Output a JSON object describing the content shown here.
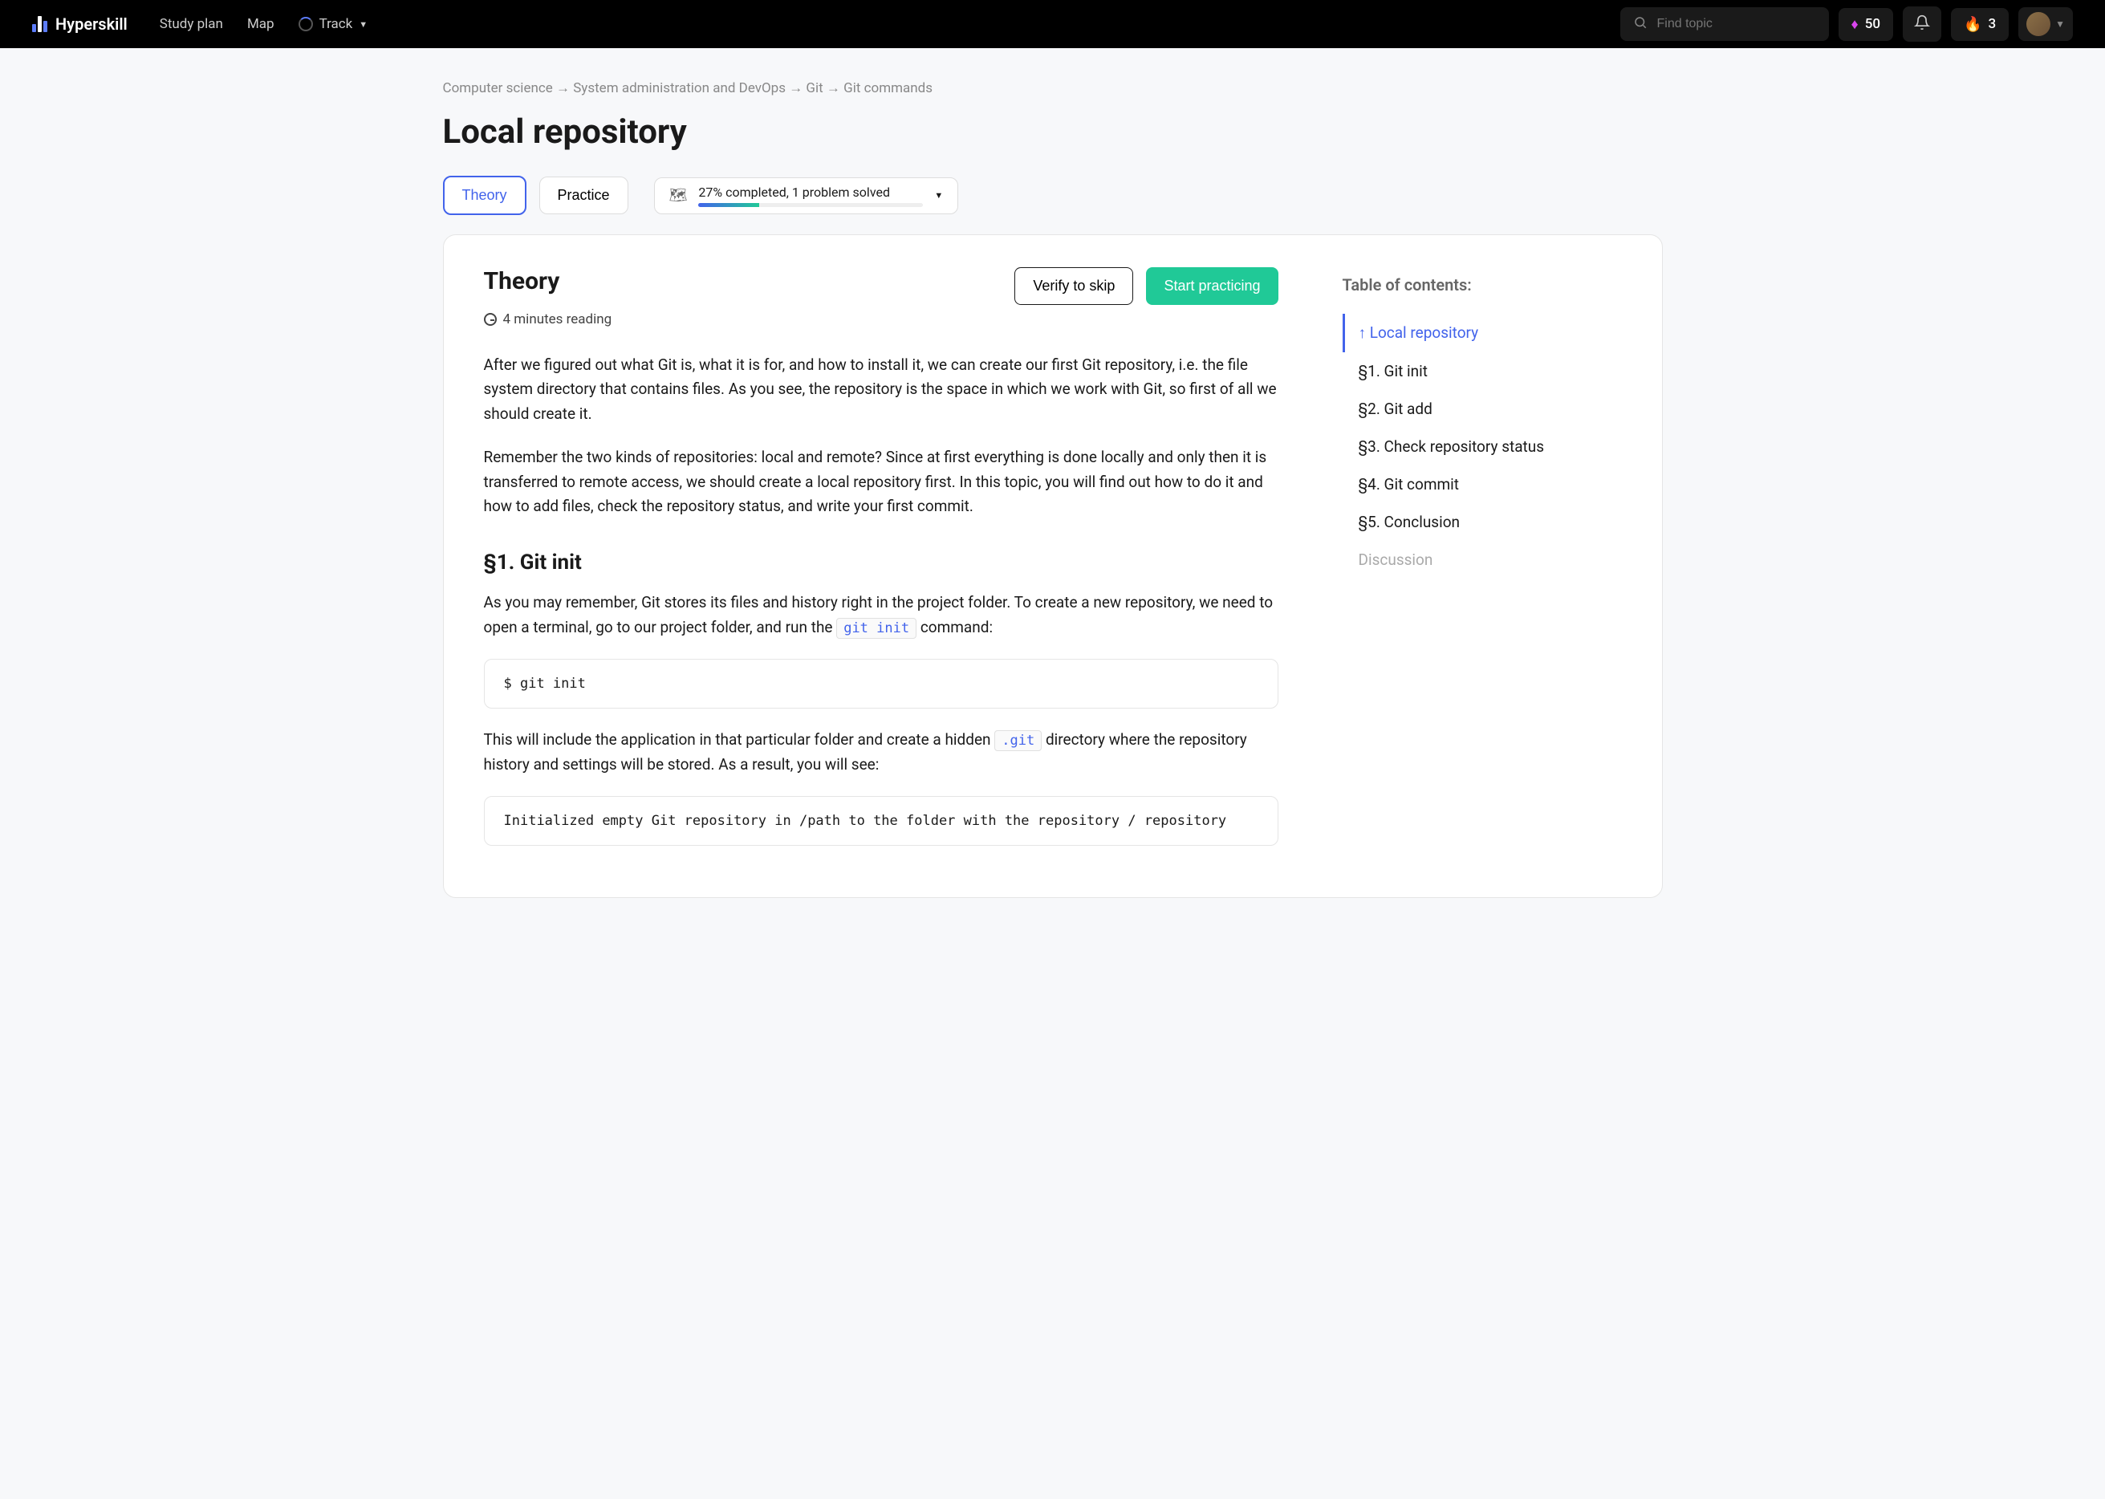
{
  "header": {
    "brand": "Hyperskill",
    "nav": {
      "study_plan": "Study plan",
      "map": "Map",
      "track": "Track"
    },
    "search_placeholder": "Find topic",
    "gems": "50",
    "streak": "3"
  },
  "breadcrumb": {
    "l1": "Computer science",
    "l2": "System administration and DevOps",
    "l3": "Git",
    "l4": "Git commands",
    "sep": "→"
  },
  "title": "Local repository",
  "tabs": {
    "theory": "Theory",
    "practice": "Practice"
  },
  "progress": {
    "label": "27% completed, 1 problem solved",
    "percent": 27
  },
  "buttons": {
    "verify": "Verify to skip",
    "start": "Start practicing"
  },
  "theory": {
    "heading": "Theory",
    "reading": "4 minutes reading",
    "p1": "After we figured out what Git is, what it is for, and how to install it, we can create our first Git repository, i.e. the file system directory that contains files. As you see, the repository is the space in which we work with Git, so first of all we should create it.",
    "p2": "Remember the two kinds of repositories: local and remote? Since at first everything is done locally and only then it is transferred to remote access, we should create a local repository first. In this topic, you will find out how to do it and how to add files, check the repository status, and write your first commit.",
    "s1_title": "§1. Git init",
    "s1_p1a": "As you may remember, Git stores its files and history right in the project folder. To create a new repository, we need to open a terminal, go to our project folder, and run the ",
    "s1_code1": "git init",
    "s1_p1b": " command:",
    "s1_block1": "$ git init",
    "s1_p2a": "This will include the application in that particular folder and create a hidden ",
    "s1_code2": ".git",
    "s1_p2b": " directory where the repository history and settings will be stored. As a result, you will see:",
    "s1_block2": "Initialized empty Git repository in /path to the folder with the repository / repository"
  },
  "toc": {
    "heading": "Table of contents:",
    "anchor": "↑ Local repository",
    "items": [
      "§1. Git init",
      "§2. Git add",
      "§3. Check repository status",
      "§4. Git commit",
      "§5. Conclusion"
    ],
    "discussion": "Discussion"
  }
}
